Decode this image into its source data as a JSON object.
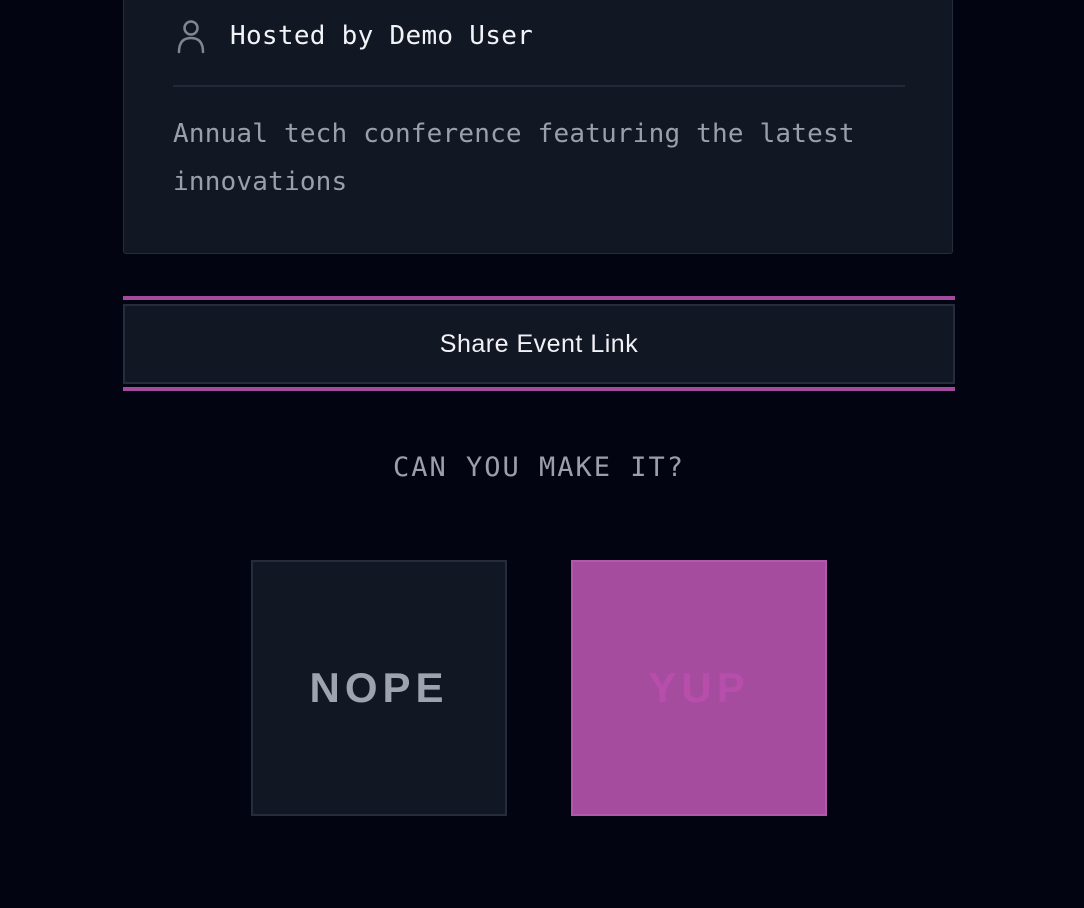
{
  "event": {
    "host_label": "Hosted by Demo User",
    "description": "Annual tech conference featuring the latest innovations"
  },
  "share": {
    "label": "Share Event Link"
  },
  "rsvp": {
    "question": "CAN YOU MAKE IT?",
    "nope_label": "NOPE",
    "yup_label": "YUP"
  },
  "icons": {
    "host": "user-icon"
  },
  "colors": {
    "background": "#030412",
    "card": "#121724",
    "accent": "#a64c9f",
    "text_primary": "#f2f3f7",
    "text_muted": "#9aa0aa"
  }
}
